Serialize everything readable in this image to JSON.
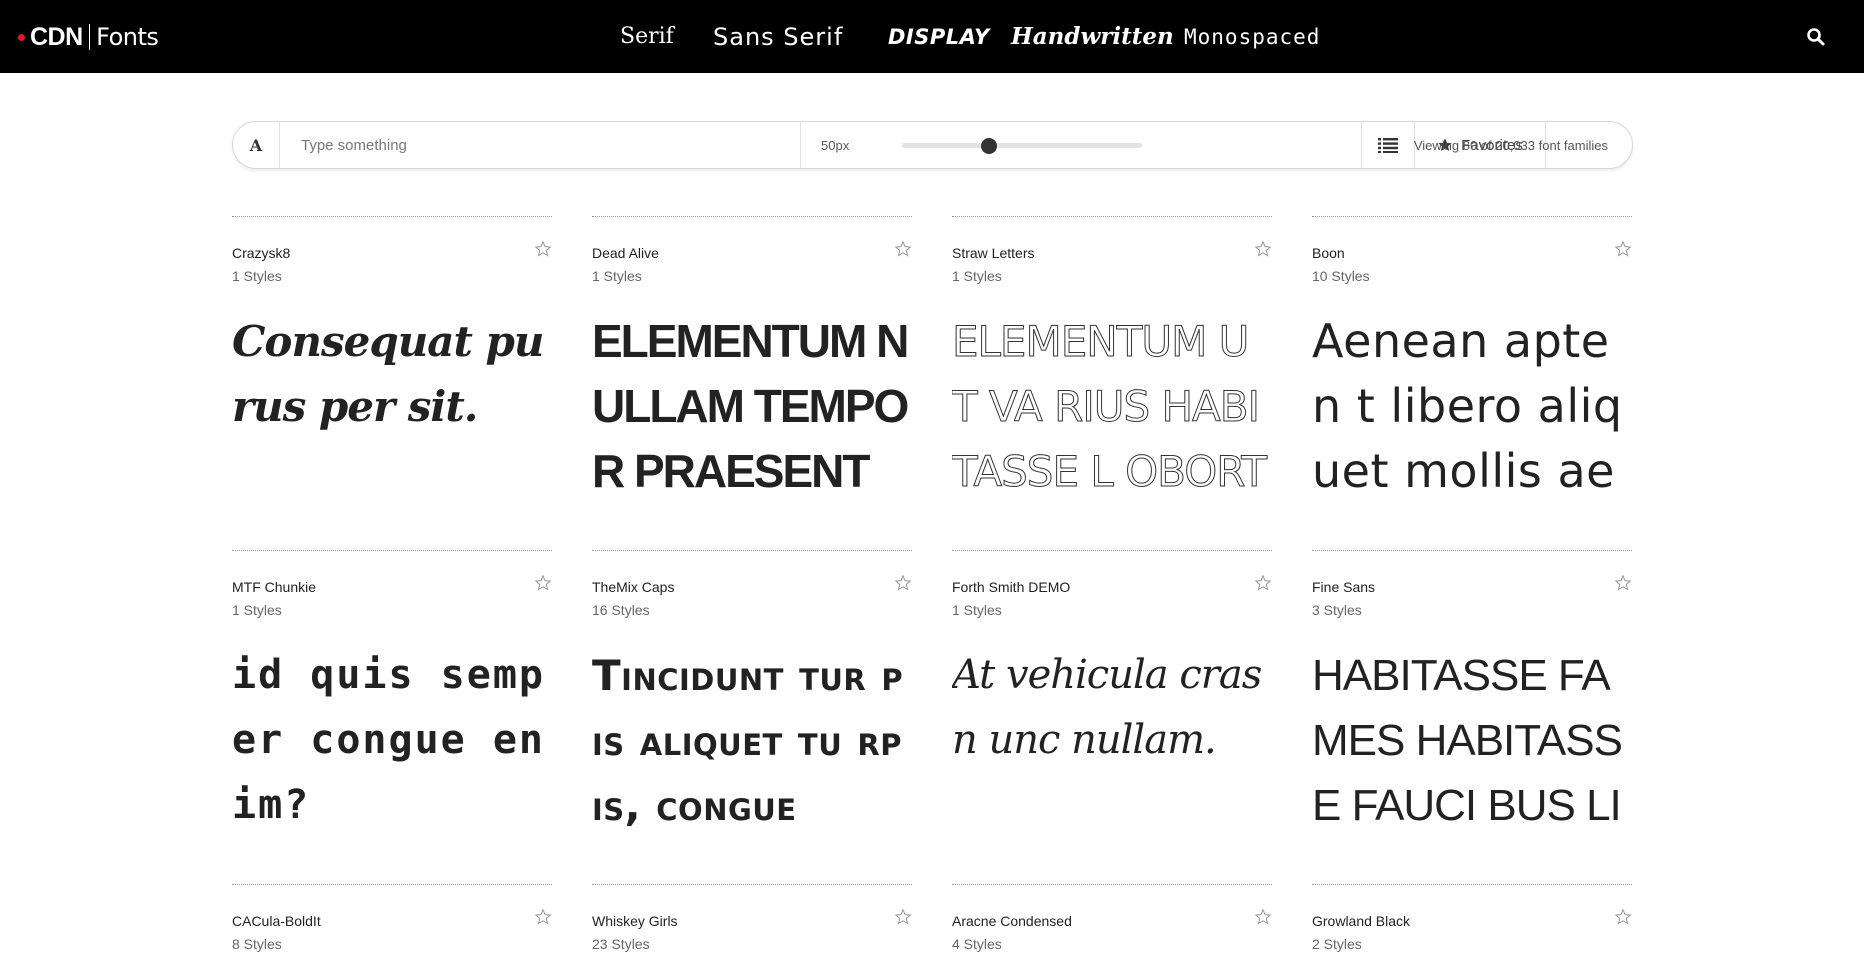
{
  "header": {
    "logo": {
      "cdn": "CDN",
      "fonts": "Fonts",
      "dot_color": "#e0181f"
    },
    "nav": [
      {
        "label": "Serif"
      },
      {
        "label": "Sans Serif"
      },
      {
        "label": "DISPLAY"
      },
      {
        "label": "Handwritten"
      },
      {
        "label": "Monospaced"
      }
    ],
    "search_icon": "search-icon"
  },
  "toolbar": {
    "font_button_label": "A",
    "input_placeholder": "Type something",
    "size_label": "50px",
    "size_value": 50,
    "list_icon": "list-icon",
    "favorites_label": "Favorites",
    "viewing_text": "Viewing 80 of 20,033 font families"
  },
  "cards": [
    {
      "name": "Crazysk8",
      "styles": "1 Styles",
      "sample": "Consequat pu rus per sit."
    },
    {
      "name": "Dead Alive",
      "styles": "1 Styles",
      "sample": "ELEMENTUM NULLAM TEMPOR PRAESENT Q UISQUE?"
    },
    {
      "name": "Straw Letters",
      "styles": "1 Styles",
      "sample": "ELEMENTUM UT VA RIUS HABITASSE L OBORTIS."
    },
    {
      "name": "Boon",
      "styles": "10 Styles",
      "sample": "Aenean apten t libero aliquet mollis aenean"
    },
    {
      "name": "MTF Chunkie",
      "styles": "1 Styles",
      "sample": "id quis semper congue enim?"
    },
    {
      "name": "TheMix Caps",
      "styles": "16 Styles",
      "sample": "Tincidunt tur pis aliquet tu rpis, congue"
    },
    {
      "name": "Forth Smith DEMO",
      "styles": "1 Styles",
      "sample": "At vehicula cras n unc nullam."
    },
    {
      "name": "Fine Sans",
      "styles": "3 Styles",
      "sample": "HABITASSE FAMES HABITASSE FAUCI BUS LITORA."
    },
    {
      "name": "CACula-BoldIt",
      "styles": "8 Styles",
      "sample": ""
    },
    {
      "name": "Whiskey Girls",
      "styles": "23 Styles",
      "sample": ""
    },
    {
      "name": "Aracne Condensed",
      "styles": "4 Styles",
      "sample": ""
    },
    {
      "name": "Growland Black",
      "styles": "2 Styles",
      "sample": ""
    }
  ]
}
